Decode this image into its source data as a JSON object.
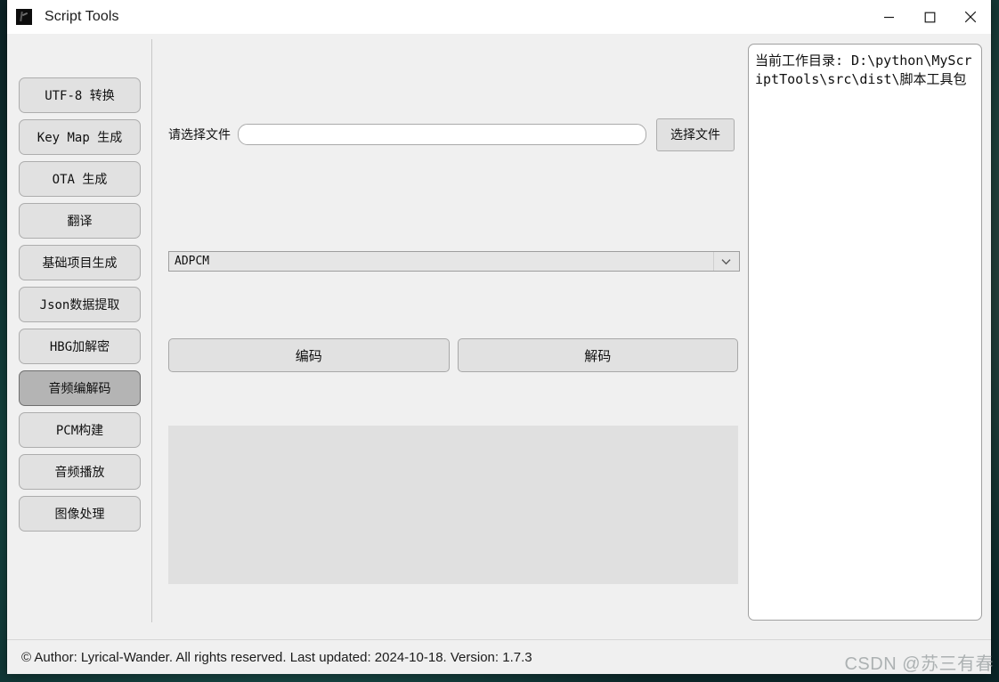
{
  "window": {
    "title": "Script Tools",
    "icon": "app-icon",
    "controls": {
      "minimize": "minimize-icon",
      "maximize": "maximize-icon",
      "close": "close-icon"
    }
  },
  "sidebar": {
    "items": [
      {
        "label": "UTF-8 转换",
        "selected": false
      },
      {
        "label": "Key Map 生成",
        "selected": false
      },
      {
        "label": "OTA 生成",
        "selected": false
      },
      {
        "label": "翻译",
        "selected": false
      },
      {
        "label": "基础项目生成",
        "selected": false
      },
      {
        "label": "Json数据提取",
        "selected": false
      },
      {
        "label": "HBG加解密",
        "selected": false
      },
      {
        "label": "音频编解码",
        "selected": true
      },
      {
        "label": "PCM构建",
        "selected": false
      },
      {
        "label": "音频播放",
        "selected": false
      },
      {
        "label": "图像处理",
        "selected": false
      }
    ]
  },
  "main": {
    "file_label": "请选择文件",
    "file_value": "",
    "file_placeholder": "",
    "file_button": "选择文件",
    "codec_selected": "ADPCM",
    "codec_chevron": "chevron-down-icon",
    "encode_button": "编码",
    "decode_button": "解码",
    "output_text": ""
  },
  "log": {
    "text": "当前工作目录: D:\\python\\MyScriptTools\\src\\dist\\脚本工具包"
  },
  "status": {
    "text": "© Author: Lyrical-Wander. All rights reserved.  Last updated: 2024-10-18. Version: 1.7.3"
  },
  "watermark": {
    "text": "CSDN @苏三有春"
  }
}
